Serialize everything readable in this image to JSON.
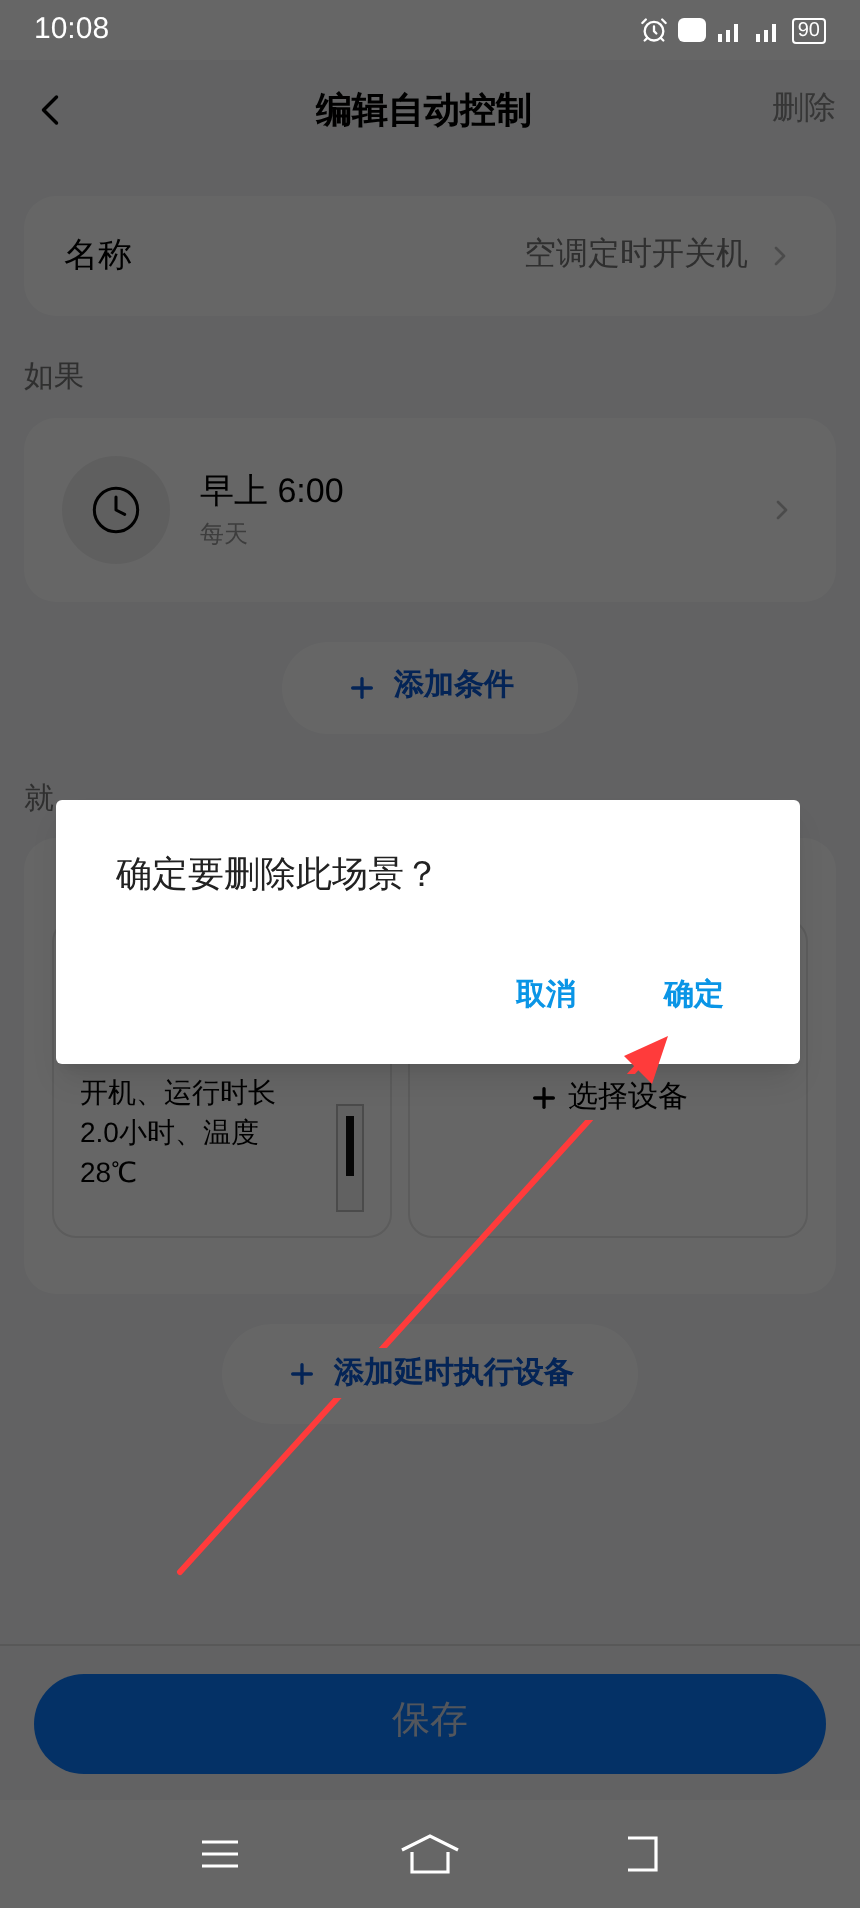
{
  "status_bar": {
    "time": "10:08",
    "battery": "90"
  },
  "header": {
    "title": "编辑自动控制",
    "action": "删除"
  },
  "name_row": {
    "label": "名称",
    "value": "空调定时开关机"
  },
  "if_section": {
    "heading": "如果",
    "condition": {
      "time": "早上 6:00",
      "repeat": "每天"
    },
    "add_button": "添加条件"
  },
  "then_section": {
    "heading": "就",
    "action_card": {
      "description": "开机、运行时长2.0小时、温度28℃"
    },
    "select_device": "选择设备",
    "add_delay_button": "添加延时执行设备"
  },
  "save_button": "保存",
  "dialog": {
    "message": "确定要删除此场景？",
    "buttons": [
      {
        "label": "取消"
      },
      {
        "label": "确定"
      }
    ]
  }
}
